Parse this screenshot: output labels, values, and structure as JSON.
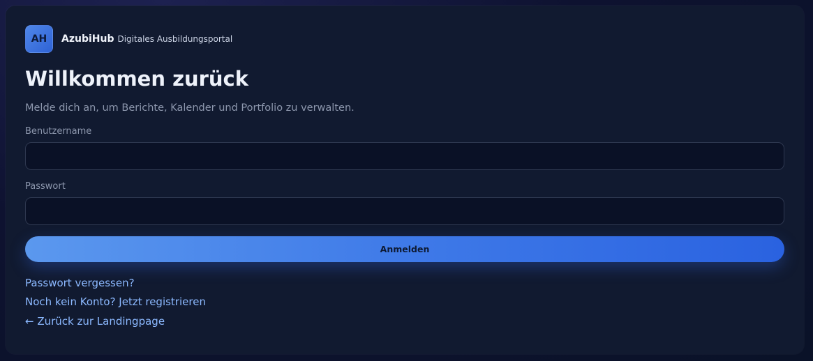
{
  "brand": {
    "logo_text": "AH",
    "name": "AzubiHub",
    "tagline": "Digitales Ausbildungsportal"
  },
  "login": {
    "title": "Willkommen zurück",
    "subtitle": "Melde dich an, um Berichte, Kalender und Portfolio zu verwalten.",
    "username_label": "Benutzername",
    "username_value": "",
    "password_label": "Passwort",
    "password_value": "",
    "submit_label": "Anmelden"
  },
  "links": {
    "forgot_password": "Passwort vergessen?",
    "register": "Noch kein Konto? Jetzt registrieren",
    "back_to_landing": "← Zurück zur Landingpage"
  },
  "colors": {
    "accent": "#3f7ae8",
    "link": "#8cb9ff",
    "card_background": "#111a30"
  }
}
